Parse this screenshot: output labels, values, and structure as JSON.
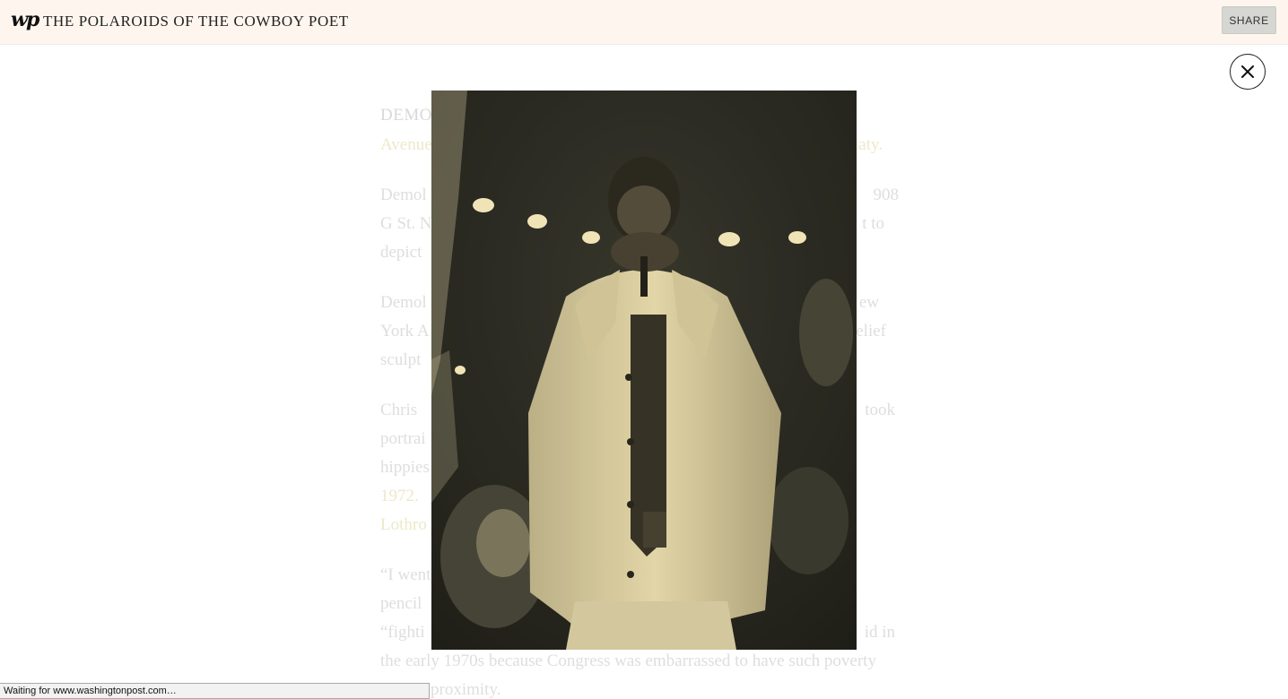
{
  "header": {
    "logo": "wp",
    "title": "THE POLAROIDS OF THE COWBOY POET",
    "share_label": "SHARE"
  },
  "modal": {
    "close_icon": "close-icon",
    "photo_description_icon": "photo"
  },
  "article": {
    "kicker": "DEMO",
    "lines": [
      {
        "left": "Avenue",
        "right": "aty."
      },
      {
        "left": "Demol",
        "right": "908"
      },
      {
        "left": "G St. N",
        "right": "t to"
      },
      {
        "left": "depict",
        "right": ""
      },
      {
        "left": "Demol",
        "right": "ew"
      },
      {
        "left": "York A",
        "right": "elief"
      },
      {
        "left": "sculpt",
        "right": ""
      },
      {
        "left": "Chris",
        "right": "took"
      },
      {
        "left": "portrai",
        "right": ""
      },
      {
        "left": "hippies",
        "right": ""
      },
      {
        "left": "1972.",
        "right": ""
      },
      {
        "left": "Lothro",
        "right": ""
      },
      {
        "left": "“I went",
        "right": ""
      },
      {
        "left": "pencil",
        "right": ""
      },
      {
        "left": "“fighti",
        "right": "id in"
      }
    ],
    "full_line_1": "the early 1970s because Congress was embarrassed to have such poverty",
    "full_line_2": "proximity."
  },
  "statusbar": {
    "text": "Waiting for www.washingtonpost.com…"
  },
  "colors": {
    "header_bg": "#fef6ee",
    "photo_tone": "#e8d9a8"
  }
}
